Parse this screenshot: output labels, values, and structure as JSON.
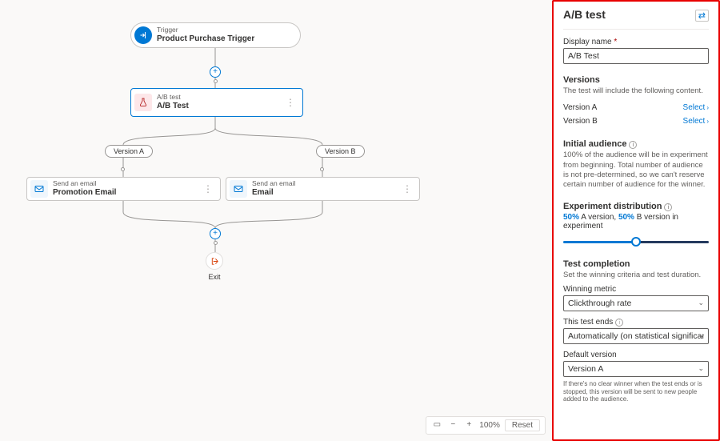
{
  "flow": {
    "trigger": {
      "kicker": "Trigger",
      "title": "Product Purchase Trigger"
    },
    "abtest": {
      "kicker": "A/B test",
      "title": "A/B Test"
    },
    "branchA_label": "Version A",
    "branchB_label": "Version B",
    "emailA": {
      "kicker": "Send an email",
      "title": "Promotion Email"
    },
    "emailB": {
      "kicker": "Send an email",
      "title": "Email"
    },
    "exit_label": "Exit"
  },
  "zoom": {
    "minus": "−",
    "plus": "+",
    "value": "100%",
    "reset": "Reset"
  },
  "panel": {
    "header": "A/B test",
    "display_name_label": "Display name",
    "display_name_value": "A/B Test",
    "versions": {
      "heading": "Versions",
      "desc": "The test will include the following content.",
      "a_label": "Version A",
      "b_label": "Version B",
      "select_text": "Select"
    },
    "audience": {
      "heading": "Initial audience",
      "desc": "100% of the audience will be in experiment from beginning. Total number of audience is not pre-determined, so we can't reserve certain number of audience for the winner."
    },
    "distribution": {
      "heading": "Experiment distribution",
      "a_pct": "50%",
      "a_txt": " A version, ",
      "b_pct": "50%",
      "b_txt": " B version in experiment"
    },
    "completion": {
      "heading": "Test completion",
      "desc": "Set the winning criteria and test duration.",
      "metric_label": "Winning metric",
      "metric_value": "Clickthrough rate",
      "ends_label": "This test ends",
      "ends_value": "Automatically (on statistical significance)",
      "default_label": "Default version",
      "default_value": "Version A",
      "footnote": "If there's no clear winner when the test ends or is stopped, this version will be sent to new people added to the audience."
    }
  }
}
